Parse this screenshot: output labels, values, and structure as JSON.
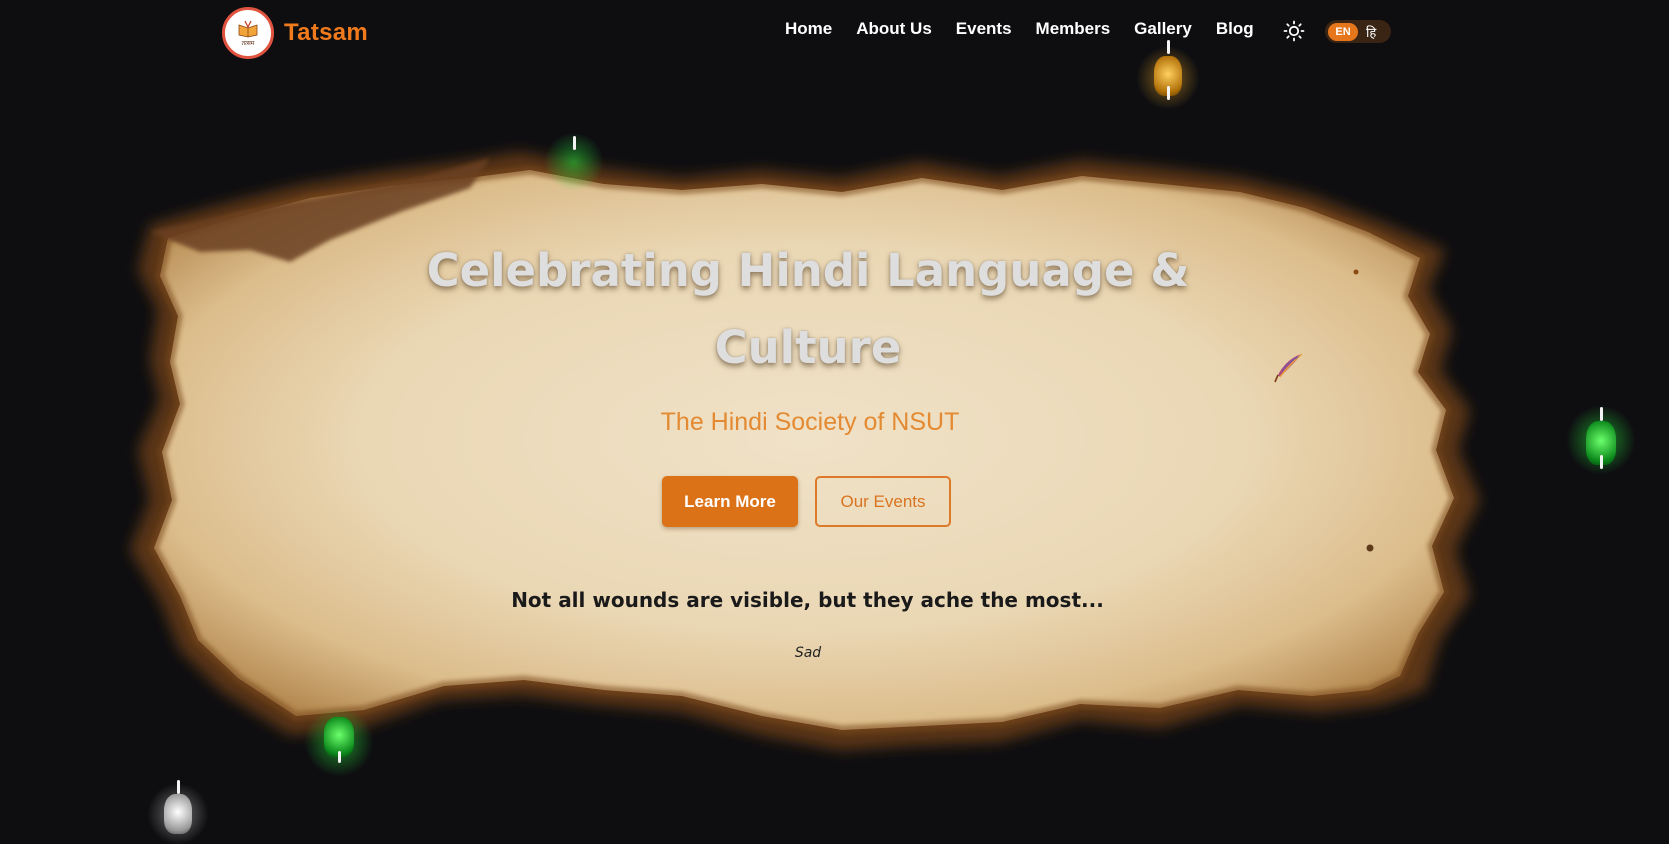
{
  "header": {
    "brand": "Tatsam",
    "logo_caption": "तत्सम",
    "nav": [
      "Home",
      "About Us",
      "Events",
      "Members",
      "Gallery",
      "Blog"
    ],
    "lang_en": "EN",
    "lang_hi": "हि"
  },
  "hero": {
    "title_line1": "Celebrating Hindi Language &",
    "title_line2": "Culture",
    "subtitle": "The Hindi Society of NSUT",
    "learn_more": "Learn More",
    "our_events": "Our Events",
    "quote": "Not all wounds are visible, but they ache the most...",
    "mood": "Sad"
  },
  "colors": {
    "background": "#0e0e11",
    "accent": "#dc7217",
    "brand": "#f07a1c",
    "lantern_green": "#22d43a",
    "lantern_amber": "#f0a21a",
    "lantern_white": "#e8e8e8"
  },
  "icons": {
    "theme": "sun-icon",
    "decoration": "feather-quill-icon",
    "lanterns": "hanging-lantern-icon"
  }
}
